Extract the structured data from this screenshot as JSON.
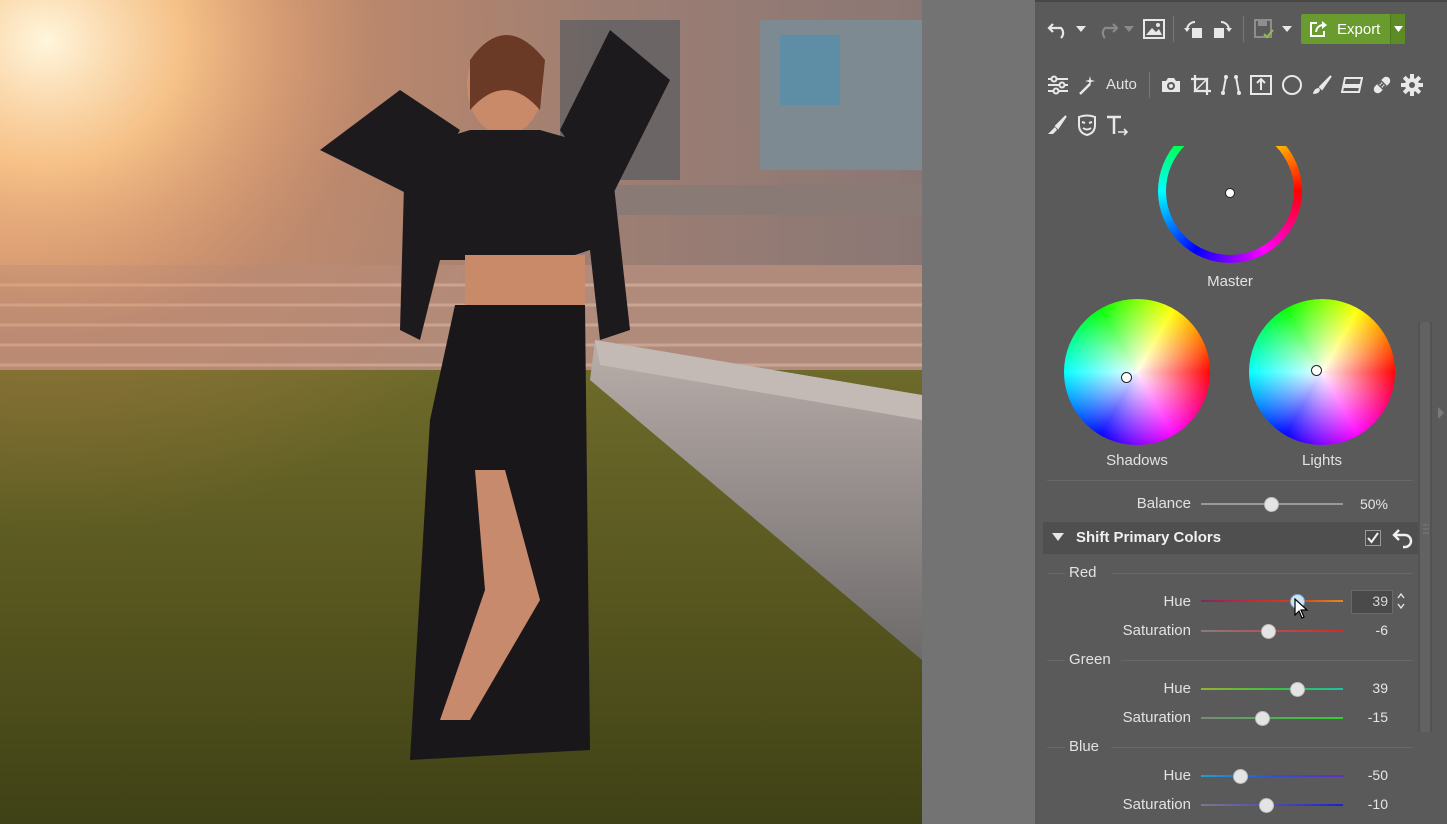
{
  "toolbar": {
    "auto_label": "Auto",
    "export_label": "Export"
  },
  "color_wheels": {
    "master_label": "Master",
    "shadows_label": "Shadows",
    "lights_label": "Lights"
  },
  "balance": {
    "label": "Balance",
    "value_text": "50%",
    "value": 0.5
  },
  "section": {
    "title": "Shift Primary Colors"
  },
  "primary_colors": {
    "red": {
      "label": "Red",
      "hue_label": "Hue",
      "hue_value": "39",
      "saturation_label": "Saturation",
      "saturation_value": "-6"
    },
    "green": {
      "label": "Green",
      "hue_label": "Hue",
      "hue_value": "39",
      "saturation_label": "Saturation",
      "saturation_value": "-15"
    },
    "blue": {
      "label": "Blue",
      "hue_label": "Hue",
      "hue_value": "-50",
      "saturation_label": "Saturation",
      "saturation_value": "-10"
    }
  },
  "colors": {
    "panel_bg": "#5a5a5a",
    "export_green": "#6a9b2e"
  }
}
